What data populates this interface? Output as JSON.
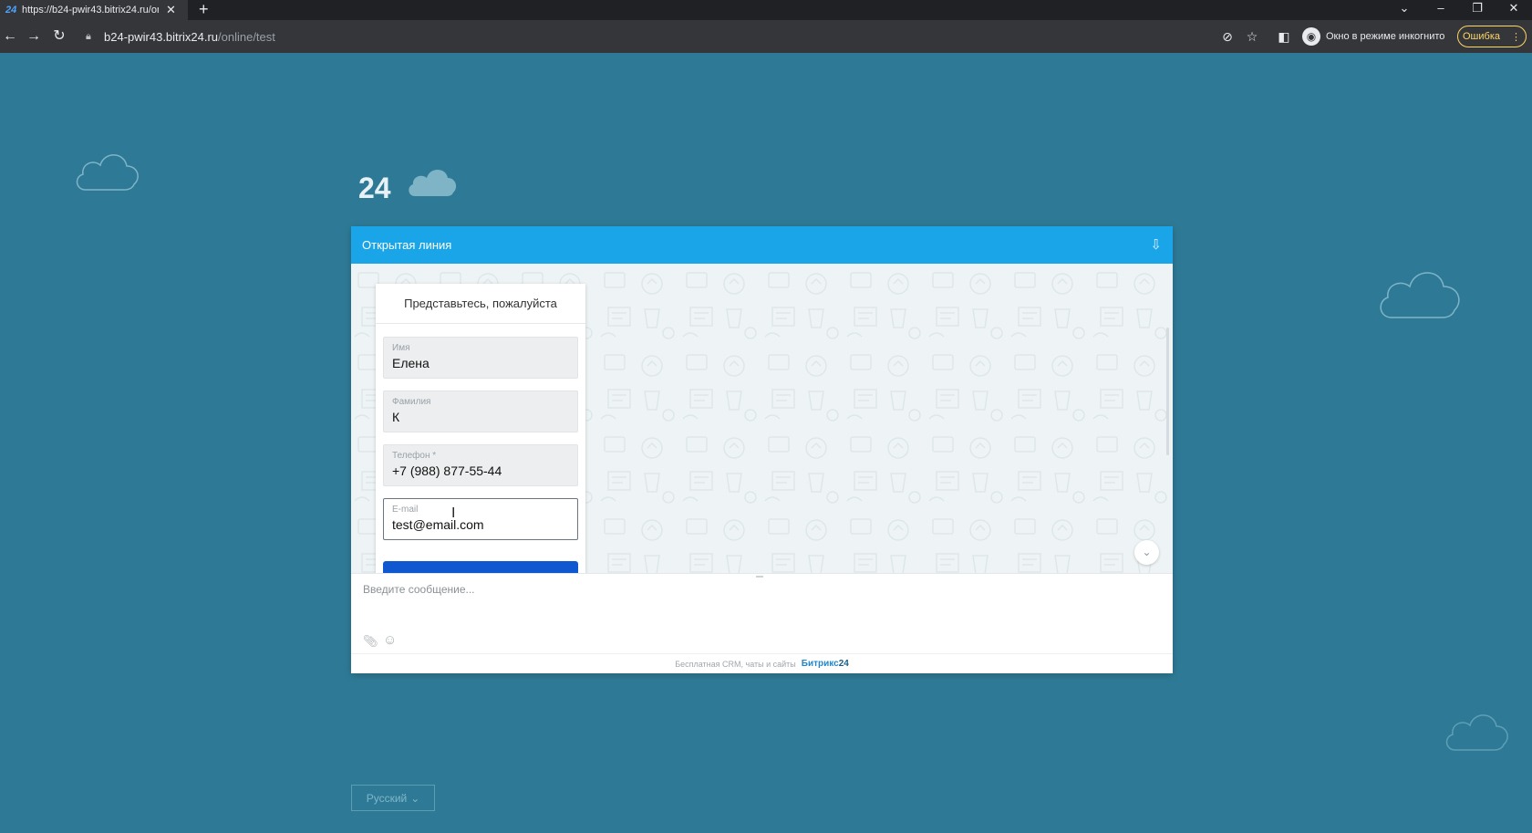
{
  "browser": {
    "tab_title": "https://b24-pwir43.bitrix24.ru/online/test",
    "url_host": "b24-pwir43.bitrix24.ru",
    "url_path": "/online/test",
    "incognito_label": "Окно в режиме инкогнито",
    "error_label": "Ошибка"
  },
  "page": {
    "logo_text": "24",
    "language_select": "Русский"
  },
  "widget": {
    "title": "Открытая линия",
    "form": {
      "title": "Представьтесь, пожалуйста",
      "fields": [
        {
          "label": "Имя",
          "value": "Елена"
        },
        {
          "label": "Фамилия",
          "value": "К"
        },
        {
          "label": "Телефон *",
          "value": "+7 (988) 877-55-44"
        },
        {
          "label": "E-mail",
          "value": "test@email.com"
        }
      ]
    },
    "message_placeholder": "Введите сообщение...",
    "footer_text": "Бесплатная CRM, чаты и сайты",
    "footer_brand": "Битрикс",
    "footer_brand_num": "24"
  },
  "colors": {
    "page_background": "#2e7a96",
    "widget_header": "#19a5e8",
    "submit_button": "#1058d0"
  }
}
